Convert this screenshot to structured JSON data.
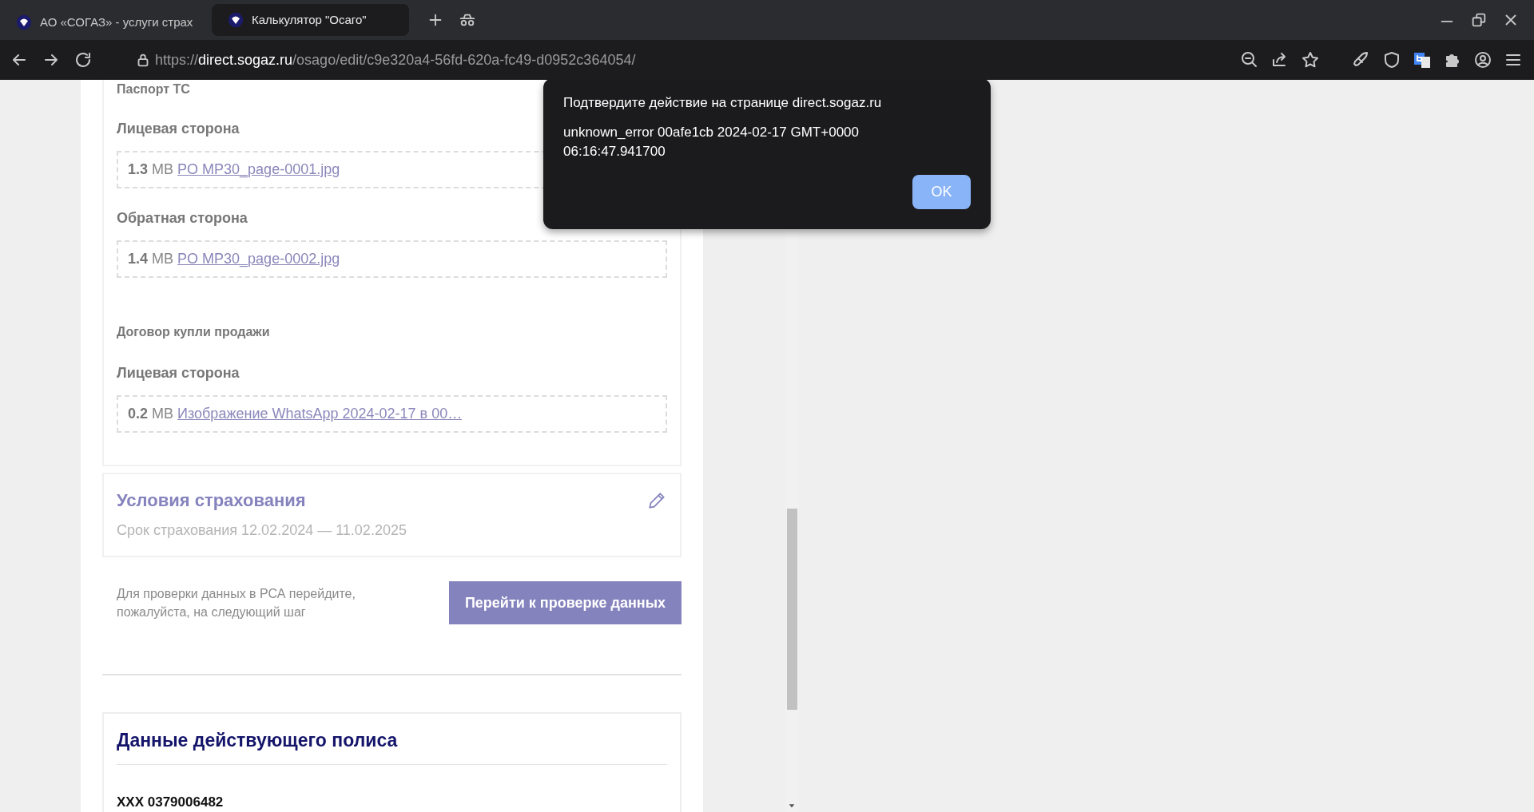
{
  "browser": {
    "tabs": [
      {
        "title": "АО «СОГАЗ» - услуги страх",
        "selected": false
      },
      {
        "title": "Калькулятор \"Осаго\"",
        "selected": true
      }
    ],
    "url": {
      "scheme": "https://",
      "host": "direct.sogaz.ru",
      "path": "/osago/edit/c9e320a4-56fd-620a-fc49-d0952c364054/"
    }
  },
  "documents": [
    {
      "title": "Паспорт ТС",
      "sides": [
        {
          "label": "Лицевая сторона",
          "size": "1.3",
          "unit": "MB",
          "file": "PO MP30_page-0001.jpg"
        },
        {
          "label": "Обратная сторона",
          "size": "1.4",
          "unit": "MB",
          "file": "PO MP30_page-0002.jpg"
        }
      ]
    },
    {
      "title": "Договор купли продажи",
      "sides": [
        {
          "label": "Лицевая сторона",
          "size": "0.2",
          "unit": "MB",
          "file": "Изображение WhatsApp 2024-02-17 в 00…"
        }
      ]
    }
  ],
  "insurance_terms": {
    "title": "Условия страхования",
    "period": "Срок страхования 12.02.2024 — 11.02.2025"
  },
  "next_step": {
    "hint": "Для проверки данных в РСА перейдите, пожалуйста, на следующий шаг",
    "button": "Перейти к проверке данных"
  },
  "policy": {
    "title": "Данные действующего полиса",
    "number": "XXX 0379006482"
  },
  "dialog": {
    "title": "Подтвердите действие на странице direct.sogaz.ru",
    "message": "unknown_error 00afe1cb 2024-02-17 GMT+0000 06:16:47.941700",
    "button": "OK"
  }
}
